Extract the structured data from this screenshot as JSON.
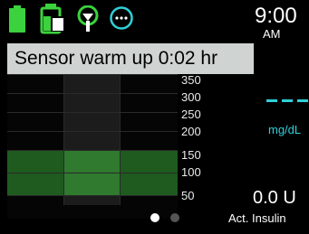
{
  "status_bar": {
    "icons": [
      "battery-icon",
      "reservoir-icon",
      "sensor-icon",
      "options-icon"
    ],
    "time": "9:00",
    "ampm": "AM"
  },
  "banner": {
    "text": "Sensor warm up 0:02 hr"
  },
  "chart": {
    "y_ticks": [
      "350",
      "300",
      "250",
      "200",
      "150",
      "100",
      "50"
    ],
    "target_range": [
      70,
      180
    ]
  },
  "glucose": {
    "units": "mg/dL"
  },
  "insulin": {
    "value": "0.0 U",
    "label": "Act. Insulin"
  },
  "pagination": {
    "current": 1,
    "total": 2
  },
  "colors": {
    "battery_green": "#3bd23d",
    "accent_cyan": "#2fd0d8",
    "banner_bg": "#cfd4d2",
    "target_band": "#1f5a1f"
  }
}
